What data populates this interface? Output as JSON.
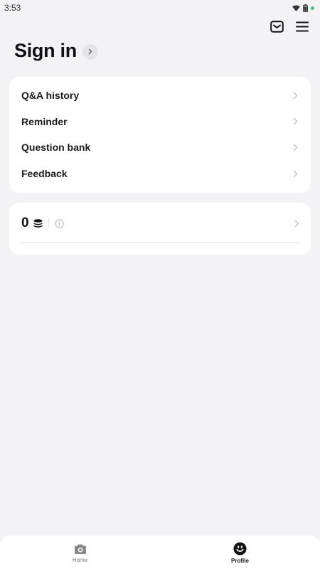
{
  "status_bar": {
    "time": "3:53"
  },
  "header": {
    "title": "Sign in"
  },
  "menu": {
    "items": [
      {
        "label": "Q&A history"
      },
      {
        "label": "Reminder"
      },
      {
        "label": "Question bank"
      },
      {
        "label": "Feedback"
      }
    ]
  },
  "points": {
    "value": "0"
  },
  "tab_bar": {
    "tabs": [
      {
        "label": "Home",
        "icon": "camera-icon",
        "active": false
      },
      {
        "label": "Profile",
        "icon": "smiley-icon",
        "active": true
      }
    ]
  },
  "colors": {
    "background": "#f3f3f6",
    "card": "#ffffff",
    "battery_dot": "#2ecc71"
  }
}
